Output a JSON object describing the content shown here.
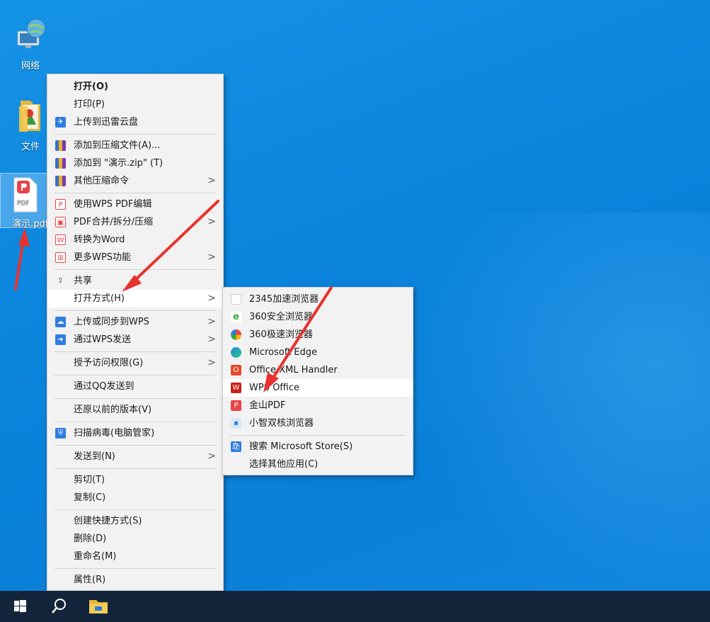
{
  "desktop": {
    "icons": [
      {
        "label": "网络",
        "icon": "network-icon"
      },
      {
        "label": "文件",
        "icon": "folder-icon"
      },
      {
        "label": "演示.pdf",
        "icon": "pdf-file-icon"
      }
    ]
  },
  "context_menu": {
    "items": [
      {
        "label": "打开(O)"
      },
      {
        "label": "打印(P)"
      },
      {
        "label": "上传到迅雷云盘",
        "icon": "xunlei-cloud-icon"
      },
      {
        "label": "添加到压缩文件(A)...",
        "icon": "archive-icon"
      },
      {
        "label": "添加到 \"演示.zip\" (T)",
        "icon": "archive-icon"
      },
      {
        "label": "其他压缩命令",
        "icon": "archive-icon"
      },
      {
        "label": "使用WPS PDF编辑",
        "icon": "wps-pdf-icon"
      },
      {
        "label": "PDF合并/拆分/压缩",
        "icon": "pdf-merge-icon"
      },
      {
        "label": "转换为Word",
        "icon": "convert-word-icon"
      },
      {
        "label": "更多WPS功能",
        "icon": "wps-more-icon"
      },
      {
        "label": "共享",
        "icon": "share-icon"
      },
      {
        "label": "打开方式(H)"
      },
      {
        "label": "上传或同步到WPS",
        "icon": "wps-cloud-icon"
      },
      {
        "label": "通过WPS发送",
        "icon": "wps-send-icon"
      },
      {
        "label": "授予访问权限(G)"
      },
      {
        "label": "通过QQ发送到"
      },
      {
        "label": "还原以前的版本(V)"
      },
      {
        "label": "扫描病毒(电脑管家)",
        "icon": "shield-icon"
      },
      {
        "label": "发送到(N)"
      },
      {
        "label": "剪切(T)"
      },
      {
        "label": "复制(C)"
      },
      {
        "label": "创建快捷方式(S)"
      },
      {
        "label": "删除(D)"
      },
      {
        "label": "重命名(M)"
      },
      {
        "label": "属性(R)"
      }
    ]
  },
  "open_with_menu": {
    "items": [
      {
        "label": "2345加速浏览器",
        "icon": "blank-file-icon"
      },
      {
        "label": "360安全浏览器",
        "icon": "360-browser-icon"
      },
      {
        "label": "360极速浏览器",
        "icon": "360-speed-browser-icon"
      },
      {
        "label": "Microsoft Edge",
        "icon": "edge-icon"
      },
      {
        "label": "Office XML Handler",
        "icon": "office-icon"
      },
      {
        "label": "WPS Office",
        "icon": "wps-office-icon"
      },
      {
        "label": "金山PDF",
        "icon": "kingsoft-pdf-icon"
      },
      {
        "label": "小智双核浏览器",
        "icon": "xiaozhi-browser-icon"
      },
      {
        "label": "搜索 Microsoft Store(S)",
        "icon": "store-icon"
      },
      {
        "label": "选择其他应用(C)"
      }
    ]
  },
  "taskbar": {
    "buttons": [
      "windows-start-icon",
      "search-icon",
      "file-explorer-icon"
    ]
  },
  "colors": {
    "desktop": "#0b84dc",
    "annotation_arrow": "#e8322e",
    "taskbar": "#13253a"
  }
}
